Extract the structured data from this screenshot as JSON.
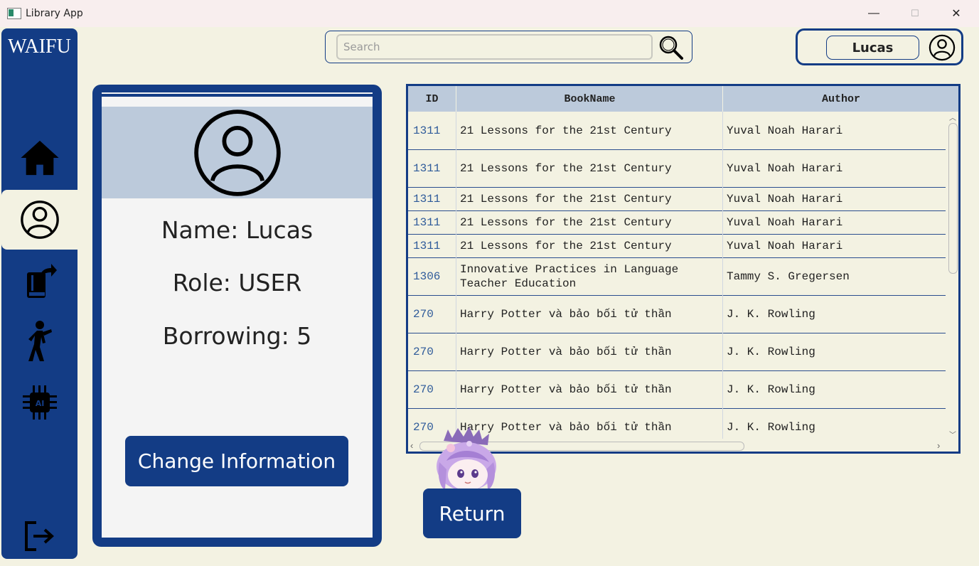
{
  "window": {
    "title": "Library App",
    "minimize": "—",
    "maximize": "☐",
    "close": "✕"
  },
  "sidebar": {
    "logo": "WAIFU",
    "items": [
      {
        "name": "home",
        "icon": "home-icon"
      },
      {
        "name": "profile",
        "icon": "user-circle-icon",
        "active": true
      },
      {
        "name": "borrow",
        "icon": "book-share-icon"
      },
      {
        "name": "activity",
        "icon": "walking-person-icon"
      },
      {
        "name": "ai",
        "icon": "ai-chip-icon"
      }
    ],
    "logout_icon": "logout-icon"
  },
  "search": {
    "placeholder": "Search",
    "value": "",
    "icon": "search-icon"
  },
  "user": {
    "name": "Lucas",
    "avatar_icon": "user-circle-icon"
  },
  "profile": {
    "name_line": "Name: Lucas",
    "role_line": "Role: USER",
    "borrowing_line": "Borrowing: 5",
    "change_button": "Change Information"
  },
  "table": {
    "columns": [
      "ID",
      "BookName",
      "Author"
    ],
    "rows": [
      {
        "id": "1311",
        "name": "21 Lessons for the 21st Century",
        "author": "Yuval Noah Harari"
      },
      {
        "id": "1311",
        "name": "21 Lessons for the 21st Century",
        "author": "Yuval Noah Harari"
      },
      {
        "id": "1311",
        "name": "21 Lessons for the 21st Century",
        "author": "Yuval Noah Harari"
      },
      {
        "id": "1311",
        "name": "21 Lessons for the 21st Century",
        "author": "Yuval Noah Harari"
      },
      {
        "id": "1311",
        "name": "21 Lessons for the 21st Century",
        "author": "Yuval Noah Harari"
      },
      {
        "id": "1306",
        "name": "Innovative Practices in Language Teacher Education",
        "author": "Tammy S. Gregersen"
      },
      {
        "id": "270",
        "name": "Harry Potter và bảo bối tử thần",
        "author": "J. K. Rowling"
      },
      {
        "id": "270",
        "name": "Harry Potter và bảo bối tử thần",
        "author": "J. K. Rowling"
      },
      {
        "id": "270",
        "name": "Harry Potter và bảo bối tử thần",
        "author": "J. K. Rowling"
      },
      {
        "id": "270",
        "name": "Harry Potter và bảo bối tử thần",
        "author": "J. K. Rowling"
      }
    ]
  },
  "return_button": "Return",
  "colors": {
    "primary": "#133c85",
    "background": "#f3f2e2",
    "header": "#bccadb"
  }
}
